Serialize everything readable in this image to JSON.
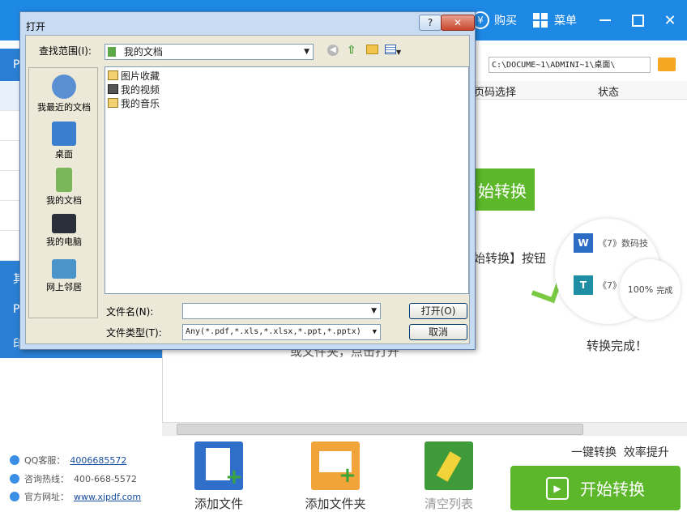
{
  "app": {
    "buy_label": "购买",
    "menu_label": "菜单",
    "path": "C:\\DOCUME~1\\ADMINI~1\\桌面\\",
    "columns": {
      "page_select": "页码选择",
      "status": "状态"
    },
    "promo": {
      "start_text": "始转换",
      "hint_text": "始转换】按钮",
      "hint_sub": "或文件夹，点击打开",
      "word_item": "《7》数码技",
      "t_item": "《7》",
      "progress_pct": "100%",
      "progress_label": "完成",
      "done_text": "转换完成！"
    },
    "sidebar": {
      "stub_labels": [
        "P",
        "其",
        "P",
        "印"
      ],
      "qq_label": "QQ客服：",
      "qq_value": "4006685572",
      "hotline_label": "咨询热线：",
      "hotline_value": "400-668-5572",
      "site_label": "官方网址：",
      "site_value": "www.xjpdf.com"
    },
    "toolbar": {
      "add_file": "添加文件",
      "add_folder": "添加文件夹",
      "clear_list": "清空列表",
      "tagline": "一键转换  效率提升",
      "start": "开始转换"
    }
  },
  "dialog": {
    "title": "打开",
    "help": "?",
    "close": "✕",
    "look_in_label": "查找范围(I):",
    "look_in_value": "我的文档",
    "places": [
      "我最近的文档",
      "桌面",
      "我的文档",
      "我的电脑",
      "网上邻居"
    ],
    "files": [
      "图片收藏",
      "我的视频",
      "我的音乐"
    ],
    "filename_label": "文件名(N):",
    "filename_value": "",
    "filetype_label": "文件类型(T):",
    "filetype_value": "Any(*.pdf,*.xls,*.xlsx,*.ppt,*.pptx)",
    "open_button": "打开(O)",
    "cancel_button": "取消"
  },
  "colors": {
    "titlebar": "#1e88e5",
    "green": "#5cb82a",
    "dialog_frame": "#c7dbf2"
  }
}
